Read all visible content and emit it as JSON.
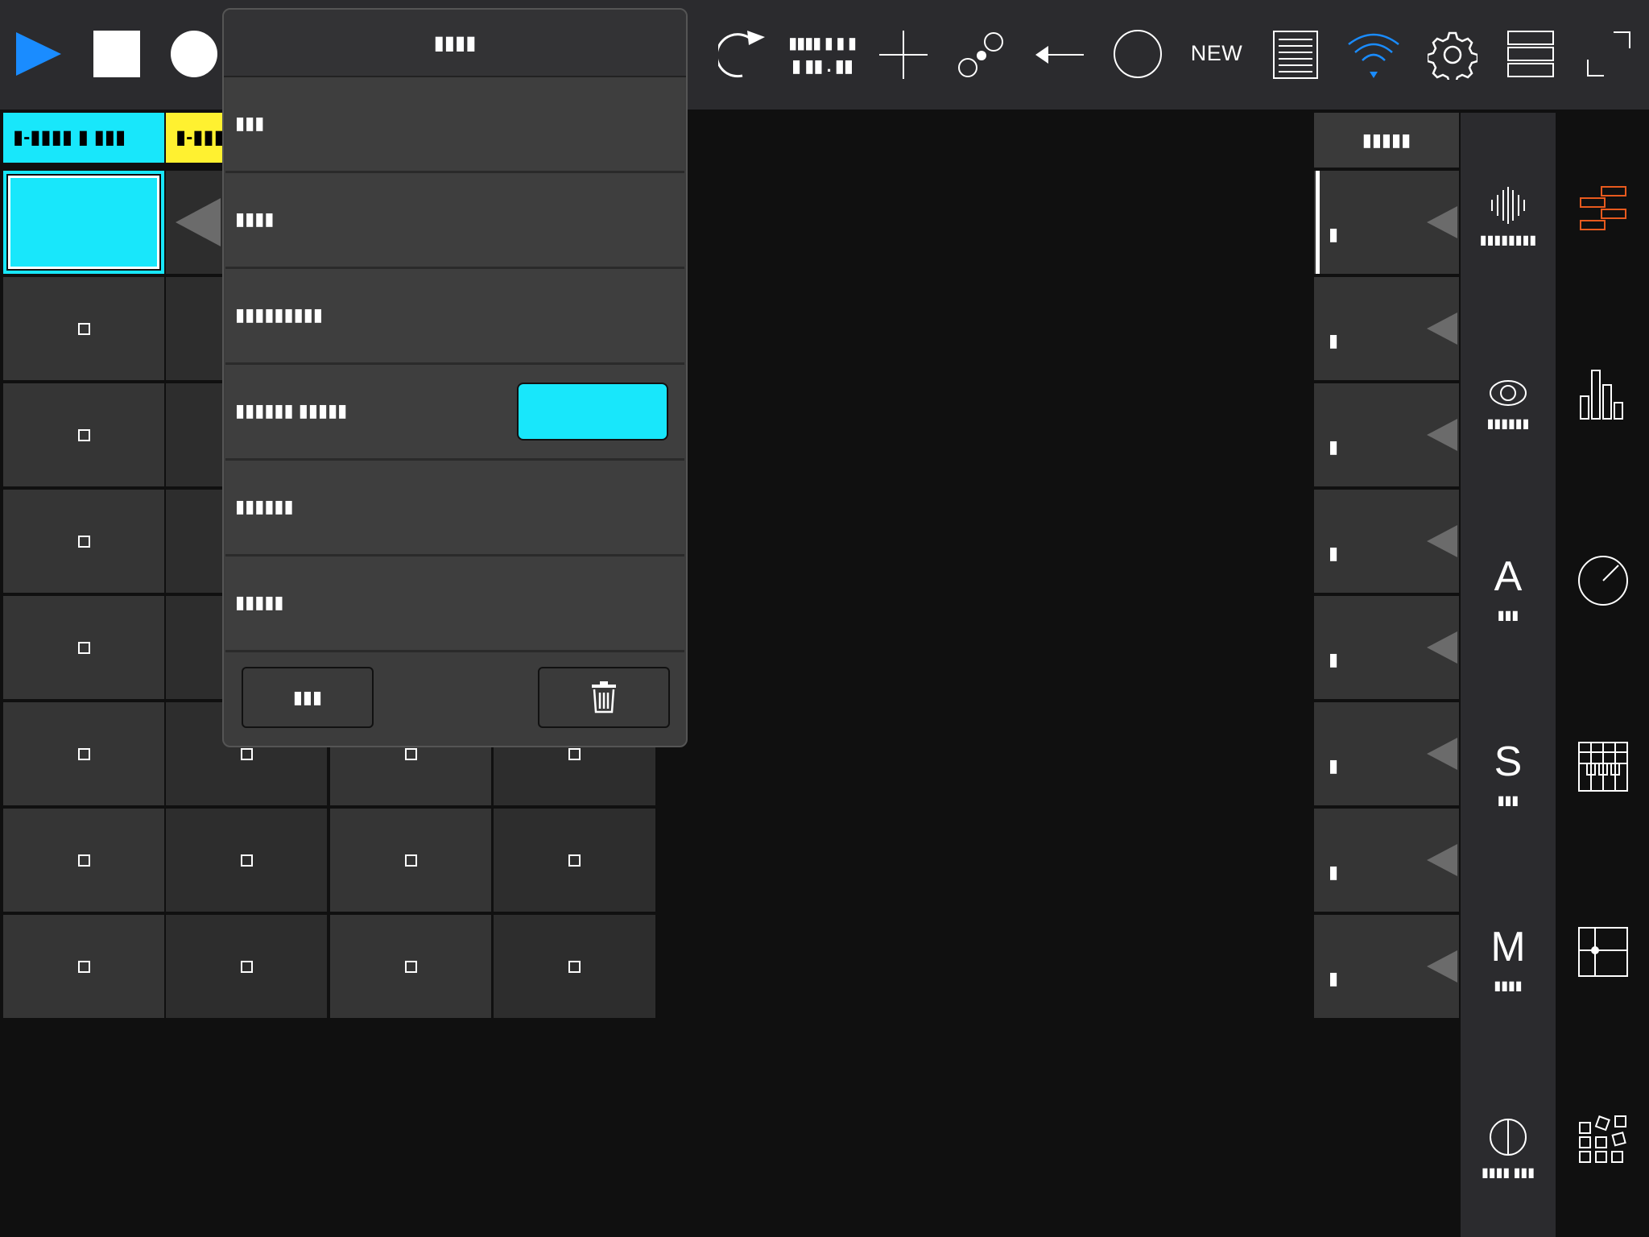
{
  "toolbar": {
    "new_label": "NEW",
    "tempo_top": "▮▮▮▮ ▮ ▮ ▮",
    "tempo_bottom": "▮ ▮▮ . ▮▮",
    "accent_color": "#1a8cff"
  },
  "tracks": [
    {
      "name": "▮-▮▮▮▮ ▮ ▮▮▮",
      "color": "#18e7fb"
    },
    {
      "name": "▮-▮▮▮",
      "color": "#fff130"
    }
  ],
  "scenes_header": "▮▮▮▮▮",
  "scene_numbers": [
    "▮",
    "▮",
    "▮",
    "▮",
    "▮",
    "▮",
    "▮",
    "▮"
  ],
  "rail": [
    {
      "icon": "waveform-icon",
      "label": "▮▮▮▮▮▮▮▮"
    },
    {
      "icon": "eye-icon",
      "label": "▮▮▮▮▮▮"
    },
    {
      "icon": "letter-a",
      "big": "A",
      "label": "▮▮▮"
    },
    {
      "icon": "letter-s",
      "big": "S",
      "label": "▮▮▮"
    },
    {
      "icon": "letter-m",
      "big": "M",
      "label": "▮▮▮▮"
    },
    {
      "icon": "circle-split-icon",
      "label": "▮▮▮▮ ▮▮▮"
    }
  ],
  "popup": {
    "title": "▮▮▮▮",
    "items": [
      "▮▮▮",
      "▮▮▮▮",
      "▮▮▮▮▮▮▮▮▮",
      "▮▮▮▮▮▮ ▮▮▮▮▮",
      "▮▮▮▮▮▮",
      "▮▮▮▮▮"
    ],
    "swatch_color": "#18e7fb",
    "left_button": "▮▮▮"
  }
}
